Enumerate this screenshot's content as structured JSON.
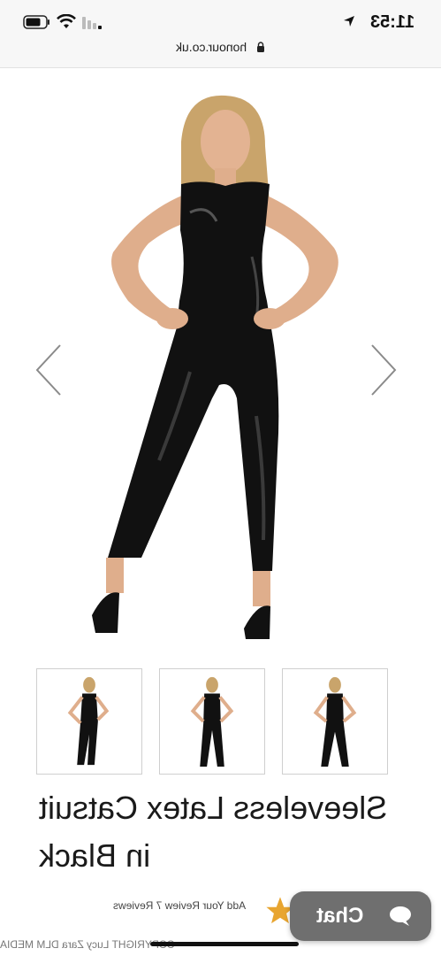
{
  "status_bar": {
    "time": "11:53",
    "url": "honour.co.uk"
  },
  "product": {
    "title_line1": "Sleeveless Latex Catsuit",
    "title_line2": "in Black",
    "reviews_text": "Add Your Review  7  Reviews",
    "thumbnail_count": 3
  },
  "chat": {
    "label": "Chat"
  },
  "copyright": "COPYRIGHT Lucy Zara DLM MEDIA",
  "icons": [
    "location-arrow-icon",
    "battery-icon",
    "wifi-icon",
    "cellular-icon",
    "lock-icon",
    "chevron-left-icon",
    "chevron-right-icon",
    "star-icon",
    "chat-bubble-icon"
  ],
  "colors": {
    "chat_bg": "#6f6f6f",
    "star": "#e8a530",
    "catsuit": "#111111"
  }
}
